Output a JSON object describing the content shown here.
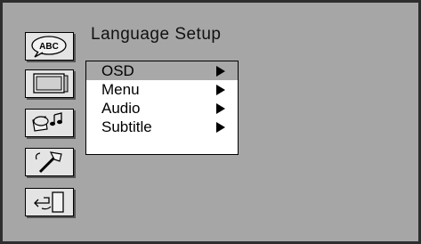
{
  "page": {
    "title": "Language Setup"
  },
  "sidebar": {
    "items": [
      {
        "icon": "language-abc-icon",
        "label": "ABC"
      },
      {
        "icon": "tv-screen-icon"
      },
      {
        "icon": "speaker-music-icon"
      },
      {
        "icon": "hammer-tools-icon"
      },
      {
        "icon": "exit-door-icon"
      }
    ]
  },
  "menu": {
    "selected_index": 0,
    "items": [
      {
        "label": "OSD"
      },
      {
        "label": "Menu"
      },
      {
        "label": "Audio"
      },
      {
        "label": "Subtitle"
      }
    ]
  },
  "colors": {
    "background": "#a6a6a6",
    "highlight": "#a8a8a8",
    "menu_bg": "#ffffff"
  }
}
